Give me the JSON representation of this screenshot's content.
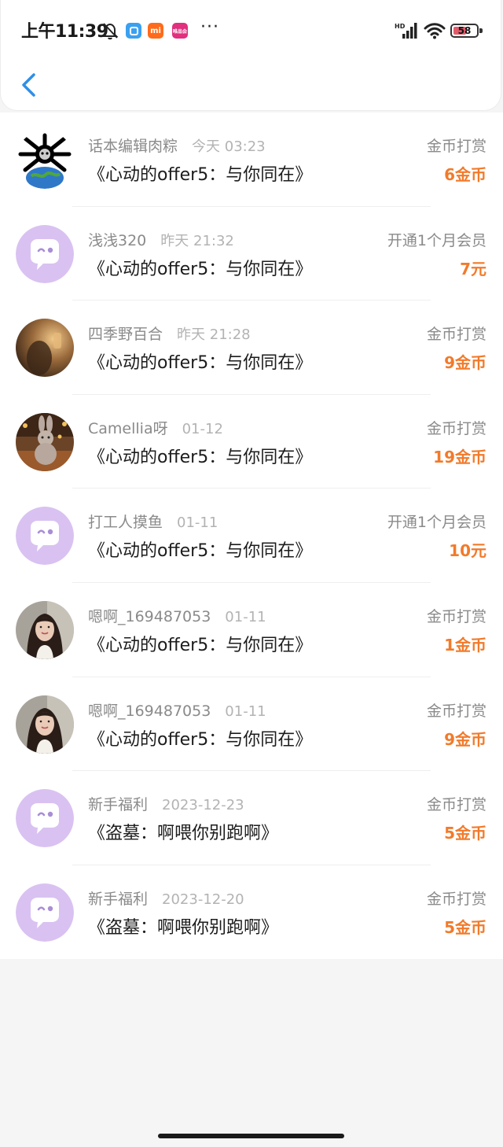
{
  "status_bar": {
    "time": "上午11:39",
    "app_icons": [
      "blue-app-icon",
      "mi-app-icon",
      "vip-app-icon"
    ],
    "mi_label": "mi",
    "vip_label": "唯品会",
    "more": "···",
    "network": "HD",
    "battery": "58",
    "battery_level": 0.58
  },
  "nav": {
    "back_icon": "chevron-left-icon",
    "accent_color": "#2f8fe8"
  },
  "colors": {
    "amount": "#f27a2a",
    "placeholder_avatar_bg": "#d9c2f1",
    "placeholder_avatar_fg": "#ffffff",
    "placeholder_avatar_mark": "#a98ed6"
  },
  "records": [
    {
      "username": "话本编辑肉粽",
      "time": "今天 03:23",
      "title": "《心动的offer5：与你同在》",
      "type": "金币打赏",
      "amount": "6金币",
      "avatar": "spider-planet"
    },
    {
      "username": "浅浅320",
      "time": "昨天 21:32",
      "title": "《心动的offer5：与你同在》",
      "type": "开通1个月会员",
      "amount": "7元",
      "avatar": "default-chat"
    },
    {
      "username": "四季野百合",
      "time": "昨天 21:28",
      "title": "《心动的offer5：与你同在》",
      "type": "金币打赏",
      "amount": "9金币",
      "avatar": "warm-photo"
    },
    {
      "username": "Camellia呀",
      "time": "01-12",
      "title": "《心动的offer5：与你同在》",
      "type": "金币打赏",
      "amount": "19金币",
      "avatar": "bunny-photo"
    },
    {
      "username": "打工人摸鱼",
      "time": "01-11",
      "title": "《心动的offer5：与你同在》",
      "type": "开通1个月会员",
      "amount": "10元",
      "avatar": "default-chat"
    },
    {
      "username": "嗯啊_169487053",
      "time": "01-11",
      "title": "《心动的offer5：与你同在》",
      "type": "金币打赏",
      "amount": "1金币",
      "avatar": "woman-photo"
    },
    {
      "username": "嗯啊_169487053",
      "time": "01-11",
      "title": "《心动的offer5：与你同在》",
      "type": "金币打赏",
      "amount": "9金币",
      "avatar": "woman-photo"
    },
    {
      "username": "新手福利",
      "time": "2023-12-23",
      "title": "《盗墓：啊喂你别跑啊》",
      "type": "金币打赏",
      "amount": "5金币",
      "avatar": "default-chat"
    },
    {
      "username": "新手福利",
      "time": "2023-12-20",
      "title": "《盗墓：啊喂你别跑啊》",
      "type": "金币打赏",
      "amount": "5金币",
      "avatar": "default-chat"
    }
  ]
}
